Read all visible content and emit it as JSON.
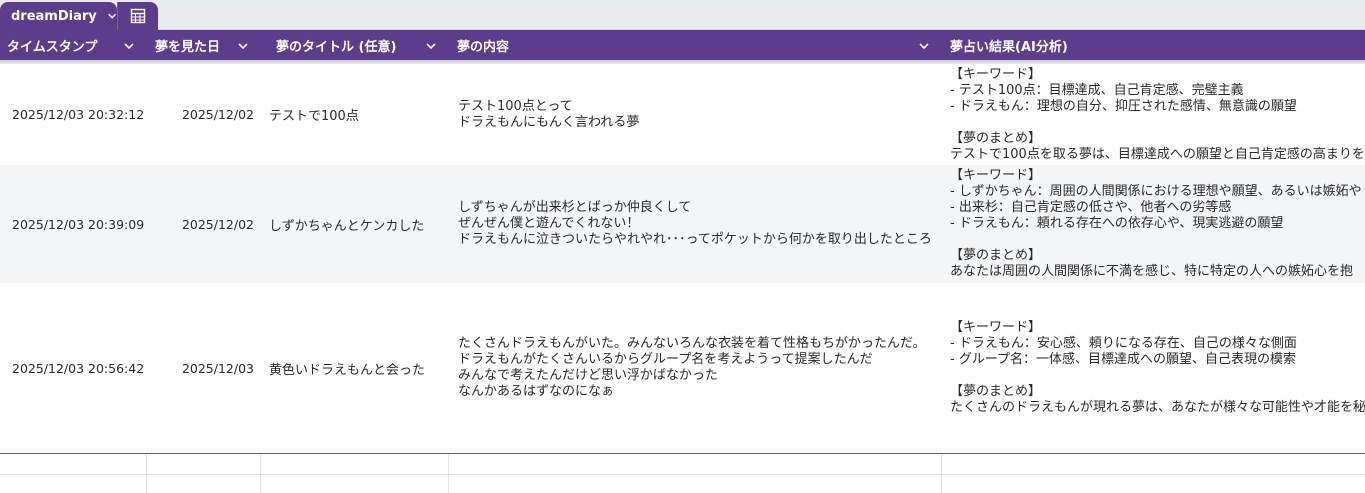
{
  "tab": {
    "sheet_name": "dreamDiary"
  },
  "header": {
    "col_timestamp": "タイムスタンプ",
    "col_date": "夢を見た日",
    "col_title": "夢のタイトル (任意)",
    "col_content": "夢の内容",
    "col_result": "夢占い結果(AI分析)"
  },
  "rows": [
    {
      "timestamp": "2025/12/03 20:32:12",
      "date": "2025/12/02",
      "title": "テストで100点",
      "content": [
        "テスト100点とって",
        "ドラえもんにもんく言われる夢"
      ],
      "result": [
        "【キーワード】",
        "- テスト100点：目標達成、自己肯定感、完璧主義",
        "- ドラえもん：理想の自分、抑圧された感情、無意識の願望",
        "",
        "【夢のまとめ】",
        "テストで100点を取る夢は、目標達成への願望と自己肯定感の高まりを"
      ]
    },
    {
      "timestamp": "2025/12/03 20:39:09",
      "date": "2025/12/02",
      "title": "しずかちゃんとケンカした",
      "content": [
        "しずちゃんが出来杉とばっか仲良くして",
        "ぜんぜん僕と遊んでくれない！",
        "ドラえもんに泣きついたらやれやれ･･･ってポケットから何かを取り出したところ"
      ],
      "result": [
        "【キーワード】",
        "- しずかちゃん：周囲の人間関係における理想や願望、あるいは嫉妬や",
        "- 出来杉：自己肯定感の低さや、他者への劣等感",
        "- ドラえもん：頼れる存在への依存心や、現実逃避の願望",
        "",
        "【夢のまとめ】",
        "あなたは周囲の人間関係に不満を感じ、特に特定の人への嫉妬心を抱"
      ]
    },
    {
      "timestamp": "2025/12/03 20:56:42",
      "date": "2025/12/03",
      "title": "黄色いドラえもんと会った",
      "content": [
        "たくさんドラえもんがいた。みんないろんな衣装を着て性格もちがかったんだ。",
        "ドラえもんがたくさんいるからグループ名を考えようって提案したんだ",
        "みんなで考えたんだけど思い浮かばなかった",
        "なんかあるはずなのになぁ"
      ],
      "result": [
        "【キーワード】",
        "- ドラえもん：安心感、頼りになる存在、自己の様々な側面",
        "- グループ名：一体感、目標達成への願望、自己表現の模索",
        "",
        "【夢のまとめ】",
        "たくさんのドラえもんが現れる夢は、あなたが様々な可能性や才能を秘"
      ]
    }
  ],
  "colors": {
    "header_bg": "#5b3d8c",
    "alt_row_bg": "#f4f5f7"
  },
  "icons": {
    "tab_menu": "chevron-down-icon",
    "view_toggle": "table-view-icon",
    "column_menu": "chevron-down-icon"
  }
}
